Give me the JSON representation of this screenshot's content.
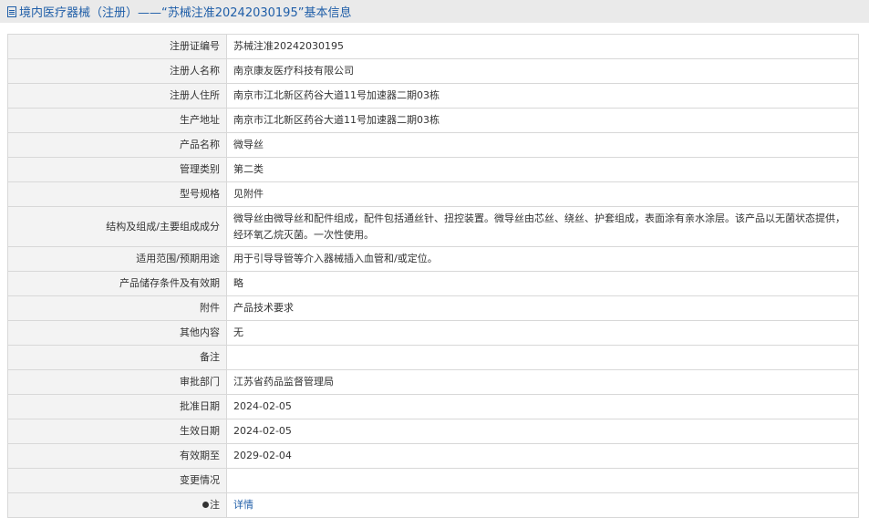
{
  "header": {
    "title": "境内医疗器械（注册）——“苏械注准20242030195”基本信息"
  },
  "record": [
    {
      "label": "注册证编号",
      "value": "苏械注准20242030195"
    },
    {
      "label": "注册人名称",
      "value": "南京康友医疗科技有限公司"
    },
    {
      "label": "注册人住所",
      "value": "南京市江北新区药谷大道11号加速器二期03栋"
    },
    {
      "label": "生产地址",
      "value": "南京市江北新区药谷大道11号加速器二期03栋"
    },
    {
      "label": "产品名称",
      "value": "微导丝"
    },
    {
      "label": "管理类别",
      "value": "第二类"
    },
    {
      "label": "型号规格",
      "value": "见附件"
    },
    {
      "label": "结构及组成/主要组成成分",
      "value": "微导丝由微导丝和配件组成，配件包括通丝针、扭控装置。微导丝由芯丝、绕丝、护套组成，表面涂有亲水涂层。该产品以无菌状态提供，经环氧乙烷灭菌。一次性使用。"
    },
    {
      "label": "适用范围/预期用途",
      "value": "用于引导导管等介入器械插入血管和/或定位。"
    },
    {
      "label": "产品储存条件及有效期",
      "value": "略"
    },
    {
      "label": "附件",
      "value": "产品技术要求"
    },
    {
      "label": "其他内容",
      "value": "无"
    },
    {
      "label": "备注",
      "value": ""
    },
    {
      "label": "审批部门",
      "value": "江苏省药品监督管理局"
    },
    {
      "label": "批准日期",
      "value": "2024-02-05"
    },
    {
      "label": "生效日期",
      "value": "2024-02-05"
    },
    {
      "label": "有效期至",
      "value": "2029-02-04"
    },
    {
      "label": "变更情况",
      "value": ""
    }
  ],
  "note": {
    "label": "注",
    "link_text": "详情",
    "icon": "pin-icon"
  },
  "colors": {
    "accent": "#1f5ea8",
    "label_bg": "#f3f3f3",
    "header_bg": "#eaeaea",
    "border": "#d8d8d8"
  }
}
